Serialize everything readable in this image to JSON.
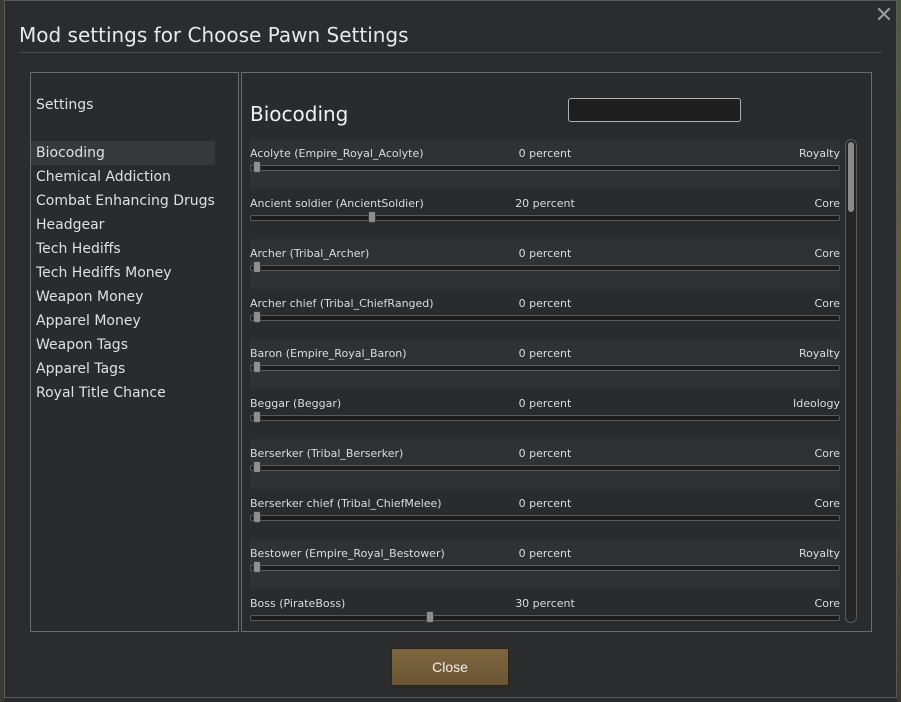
{
  "window": {
    "title": "Mod settings for Choose Pawn Settings",
    "close_icon": "✕",
    "close_button_label": "Close"
  },
  "left_panel": {
    "header": "Settings",
    "categories": [
      {
        "label": "Biocoding",
        "selected": true
      },
      {
        "label": "Chemical Addiction"
      },
      {
        "label": "Combat Enhancing Drugs"
      },
      {
        "label": "Headgear"
      },
      {
        "label": "Tech Hediffs"
      },
      {
        "label": "Tech Hediffs Money"
      },
      {
        "label": "Weapon Money"
      },
      {
        "label": "Apparel Money"
      },
      {
        "label": "Weapon Tags"
      },
      {
        "label": "Apparel Tags"
      },
      {
        "label": "Royal Title Chance"
      }
    ]
  },
  "main": {
    "section_title": "Biocoding",
    "search": {
      "value": "",
      "placeholder": ""
    },
    "rows": [
      {
        "name": "Acolyte (Empire_Royal_Acolyte)",
        "value_label": "0 percent",
        "percent": 0,
        "source": "Royalty"
      },
      {
        "name": "Ancient soldier (AncientSoldier)",
        "value_label": "20 percent",
        "percent": 20,
        "source": "Core"
      },
      {
        "name": "Archer (Tribal_Archer)",
        "value_label": "0 percent",
        "percent": 0,
        "source": "Core"
      },
      {
        "name": "Archer chief (Tribal_ChiefRanged)",
        "value_label": "0 percent",
        "percent": 0,
        "source": "Core"
      },
      {
        "name": "Baron (Empire_Royal_Baron)",
        "value_label": "0 percent",
        "percent": 0,
        "source": "Royalty"
      },
      {
        "name": "Beggar (Beggar)",
        "value_label": "0 percent",
        "percent": 0,
        "source": "Ideology"
      },
      {
        "name": "Berserker (Tribal_Berserker)",
        "value_label": "0 percent",
        "percent": 0,
        "source": "Core"
      },
      {
        "name": "Berserker chief (Tribal_ChiefMelee)",
        "value_label": "0 percent",
        "percent": 0,
        "source": "Core"
      },
      {
        "name": "Bestower (Empire_Royal_Bestower)",
        "value_label": "0 percent",
        "percent": 0,
        "source": "Royalty"
      },
      {
        "name": "Boss (PirateBoss)",
        "value_label": "30 percent",
        "percent": 30,
        "source": "Core"
      }
    ]
  },
  "colors": {
    "button_brown": "#7e6640",
    "background": "#2b2c2e"
  }
}
